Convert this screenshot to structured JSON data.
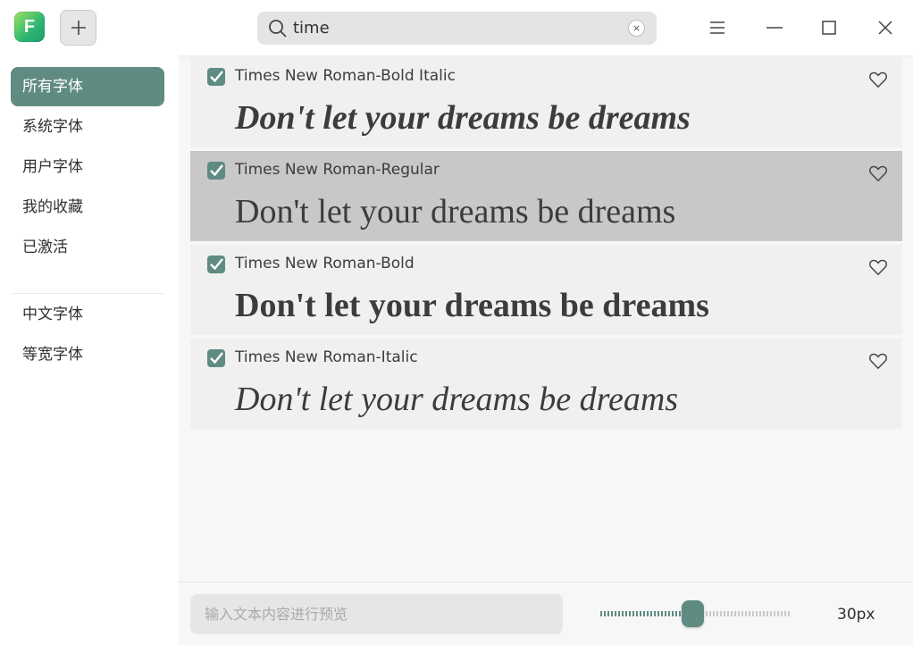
{
  "app": {
    "logo_letter": "F"
  },
  "search": {
    "value": "time",
    "clear_glyph": "×"
  },
  "sidebar": {
    "items": [
      {
        "label": "所有字体",
        "active": true
      },
      {
        "label": "系统字体",
        "active": false
      },
      {
        "label": "用户字体",
        "active": false
      },
      {
        "label": "我的收藏",
        "active": false
      },
      {
        "label": "已激活",
        "active": false
      }
    ],
    "groups": [
      {
        "label": "中文字体"
      },
      {
        "label": "等宽字体"
      }
    ]
  },
  "fonts": [
    {
      "name": "Times New Roman-Bold Italic",
      "preview": "Don't let your dreams be dreams",
      "style": "bold-italic",
      "checked": true,
      "favorite": false,
      "selected": false
    },
    {
      "name": "Times New Roman-Regular",
      "preview": "Don't let your dreams be dreams",
      "style": "regular",
      "checked": true,
      "favorite": false,
      "selected": true
    },
    {
      "name": "Times New Roman-Bold",
      "preview": "Don't let your dreams be dreams",
      "style": "bold",
      "checked": true,
      "favorite": false,
      "selected": false
    },
    {
      "name": "Times New Roman-Italic",
      "preview": "Don't let your dreams be dreams",
      "style": "italic",
      "checked": true,
      "favorite": false,
      "selected": false
    }
  ],
  "preview_input": {
    "placeholder": "输入文本内容进行预览",
    "value": ""
  },
  "size": {
    "label": "30px",
    "slider_fraction": 0.45
  },
  "colors": {
    "accent": "#5f8b82",
    "selected_row": "#c8c8c8",
    "row": "#f0f0f0"
  }
}
